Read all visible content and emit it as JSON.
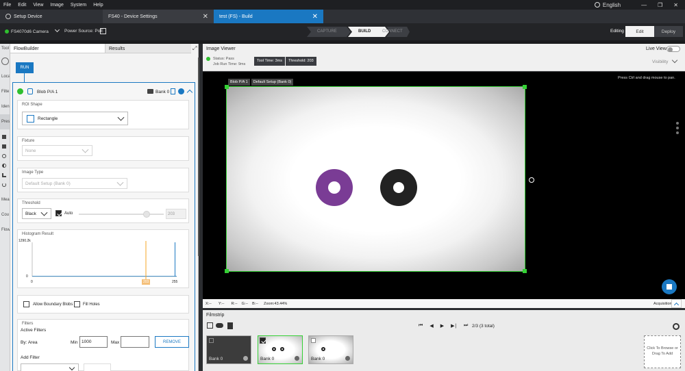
{
  "menu": [
    "File",
    "Edit",
    "View",
    "Image",
    "System",
    "Help"
  ],
  "language": "English",
  "tabs": [
    {
      "label": "Setup Device"
    },
    {
      "label": "FS40 - Device Settings"
    },
    {
      "label": "test  (FS) - Build"
    }
  ],
  "toolbar": {
    "camera": "FS4070d6 Camera",
    "power_label": "Power Source: PoE",
    "steps": [
      "CAPTURE",
      "BUILD",
      "CONNECT"
    ],
    "mode": "Editing",
    "edit": "Edit",
    "deploy": "Deploy"
  },
  "leftstrip": [
    "Tool",
    "Loca",
    "Filte",
    "Iden",
    "Pres",
    "Mea",
    "Cou",
    "Flow"
  ],
  "flowbuilder": {
    "tab_flow": "FlowBuilder",
    "tab_results": "Results",
    "run": "RUN",
    "tool_name": "Blob P/A 1",
    "bank": "Bank 0",
    "roi_title": "ROI Shape",
    "roi_value": "Rectangle",
    "fixture_title": "Fixture",
    "fixture_value": "None",
    "image_type_title": "Image Type",
    "image_type_value": "Default Setup (Bank 0)",
    "threshold_title": "Threshold",
    "threshold_mode": "Black",
    "auto_label": "Auto",
    "threshold_value": "203",
    "threshold_fraction": 0.796,
    "histogram_title": "Histogram Result",
    "hist_ymax": "1290.2k",
    "hist_y0": "0",
    "hist_x0": "0",
    "hist_x1": "255",
    "hist_marker": "203",
    "allow_boundary": "Allow Boundary Blobs",
    "fill_holes": "Fill Holes",
    "filters_title": "Filters",
    "active_filters": "Active Filters",
    "by_label": "By: Area",
    "min_label": "Min",
    "min_value": "1000",
    "max_label": "Max",
    "max_value": "",
    "remove": "REMOVE",
    "add_filter": "Add Filter"
  },
  "viewer": {
    "title": "Image Viewer",
    "live_view": "Live View",
    "status": "Status:  Pass",
    "job_time": "Job Run Time:  9ms",
    "tool_time": "Tool Time: 3ms",
    "threshold_badge": "Threshold: 203",
    "visibility": "Visibility",
    "pan_hint": "Press Ctrl and drag mouse to pan.",
    "roi_label": "Blob P/A 1",
    "roi_sub": "Default Setup (Bank 0)",
    "coords": [
      "X:--",
      "Y:--",
      "R:--",
      "G:--",
      "B:--",
      "Zoom:43.44%"
    ],
    "acquisition": "Acquisition"
  },
  "filmstrip": {
    "title": "Filmstrip",
    "counter": "2/3 (3 total)",
    "thumbs": [
      "Bank 0",
      "Bank 0",
      "Bank 0"
    ],
    "drop_hint": "Click To Browse or Drag To Add"
  },
  "colors": {
    "accent": "#1a78c2",
    "roi": "#35d135",
    "purple": "#7a3c95",
    "pass": "#2fbf2f"
  }
}
